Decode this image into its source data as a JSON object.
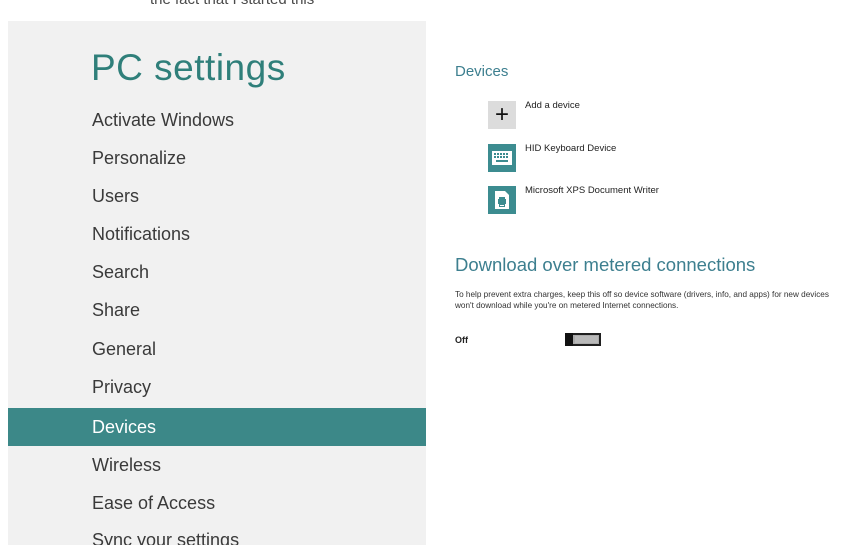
{
  "header_cut_text": "the fact that I started this",
  "sidebar": {
    "title": "PC settings",
    "items": [
      {
        "label": "Activate Windows"
      },
      {
        "label": "Personalize"
      },
      {
        "label": "Users"
      },
      {
        "label": "Notifications"
      },
      {
        "label": "Search"
      },
      {
        "label": "Share"
      },
      {
        "label": "General"
      },
      {
        "label": "Privacy"
      },
      {
        "label": "Devices",
        "selected": true
      },
      {
        "label": "Wireless"
      },
      {
        "label": "Ease of Access"
      },
      {
        "label": "Sync your settings"
      }
    ]
  },
  "devices": {
    "title": "Devices",
    "items": [
      {
        "label": "Add a device",
        "icon": "plus-icon"
      },
      {
        "label": "HID Keyboard Device",
        "icon": "keyboard-icon"
      },
      {
        "label": "Microsoft XPS Document Writer",
        "icon": "printer-icon"
      }
    ]
  },
  "metered": {
    "title": "Download over metered connections",
    "description": "To help prevent extra charges, keep this off so device software (drivers, info, and apps) for new devices won't download while you're on metered Internet connections.",
    "toggle_label": "Off",
    "toggle_on": false
  },
  "colors": {
    "accent": "#3c8888",
    "title": "#2f7f7a",
    "sidebar_bg": "#f1f1f1"
  }
}
